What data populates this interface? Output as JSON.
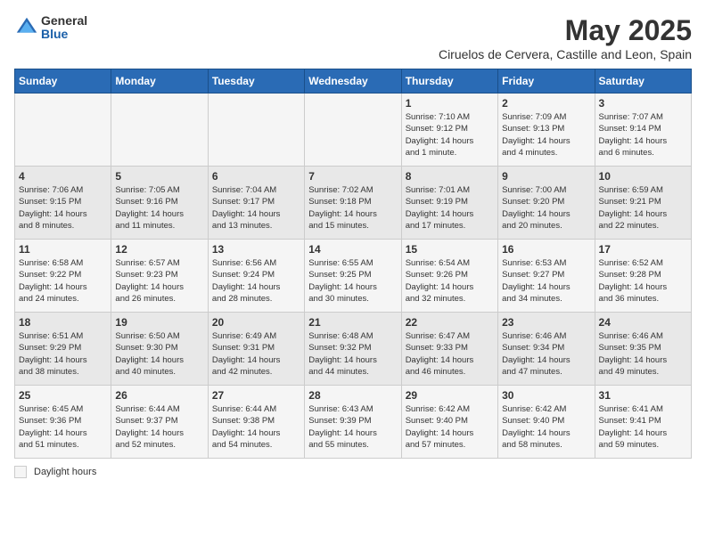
{
  "logo": {
    "general": "General",
    "blue": "Blue"
  },
  "title": "May 2025",
  "subtitle": "Ciruelos de Cervera, Castille and Leon, Spain",
  "columns": [
    "Sunday",
    "Monday",
    "Tuesday",
    "Wednesday",
    "Thursday",
    "Friday",
    "Saturday"
  ],
  "weeks": [
    [
      {
        "day": "",
        "info": ""
      },
      {
        "day": "",
        "info": ""
      },
      {
        "day": "",
        "info": ""
      },
      {
        "day": "",
        "info": ""
      },
      {
        "day": "1",
        "info": "Sunrise: 7:10 AM\nSunset: 9:12 PM\nDaylight: 14 hours\nand 1 minute."
      },
      {
        "day": "2",
        "info": "Sunrise: 7:09 AM\nSunset: 9:13 PM\nDaylight: 14 hours\nand 4 minutes."
      },
      {
        "day": "3",
        "info": "Sunrise: 7:07 AM\nSunset: 9:14 PM\nDaylight: 14 hours\nand 6 minutes."
      }
    ],
    [
      {
        "day": "4",
        "info": "Sunrise: 7:06 AM\nSunset: 9:15 PM\nDaylight: 14 hours\nand 8 minutes."
      },
      {
        "day": "5",
        "info": "Sunrise: 7:05 AM\nSunset: 9:16 PM\nDaylight: 14 hours\nand 11 minutes."
      },
      {
        "day": "6",
        "info": "Sunrise: 7:04 AM\nSunset: 9:17 PM\nDaylight: 14 hours\nand 13 minutes."
      },
      {
        "day": "7",
        "info": "Sunrise: 7:02 AM\nSunset: 9:18 PM\nDaylight: 14 hours\nand 15 minutes."
      },
      {
        "day": "8",
        "info": "Sunrise: 7:01 AM\nSunset: 9:19 PM\nDaylight: 14 hours\nand 17 minutes."
      },
      {
        "day": "9",
        "info": "Sunrise: 7:00 AM\nSunset: 9:20 PM\nDaylight: 14 hours\nand 20 minutes."
      },
      {
        "day": "10",
        "info": "Sunrise: 6:59 AM\nSunset: 9:21 PM\nDaylight: 14 hours\nand 22 minutes."
      }
    ],
    [
      {
        "day": "11",
        "info": "Sunrise: 6:58 AM\nSunset: 9:22 PM\nDaylight: 14 hours\nand 24 minutes."
      },
      {
        "day": "12",
        "info": "Sunrise: 6:57 AM\nSunset: 9:23 PM\nDaylight: 14 hours\nand 26 minutes."
      },
      {
        "day": "13",
        "info": "Sunrise: 6:56 AM\nSunset: 9:24 PM\nDaylight: 14 hours\nand 28 minutes."
      },
      {
        "day": "14",
        "info": "Sunrise: 6:55 AM\nSunset: 9:25 PM\nDaylight: 14 hours\nand 30 minutes."
      },
      {
        "day": "15",
        "info": "Sunrise: 6:54 AM\nSunset: 9:26 PM\nDaylight: 14 hours\nand 32 minutes."
      },
      {
        "day": "16",
        "info": "Sunrise: 6:53 AM\nSunset: 9:27 PM\nDaylight: 14 hours\nand 34 minutes."
      },
      {
        "day": "17",
        "info": "Sunrise: 6:52 AM\nSunset: 9:28 PM\nDaylight: 14 hours\nand 36 minutes."
      }
    ],
    [
      {
        "day": "18",
        "info": "Sunrise: 6:51 AM\nSunset: 9:29 PM\nDaylight: 14 hours\nand 38 minutes."
      },
      {
        "day": "19",
        "info": "Sunrise: 6:50 AM\nSunset: 9:30 PM\nDaylight: 14 hours\nand 40 minutes."
      },
      {
        "day": "20",
        "info": "Sunrise: 6:49 AM\nSunset: 9:31 PM\nDaylight: 14 hours\nand 42 minutes."
      },
      {
        "day": "21",
        "info": "Sunrise: 6:48 AM\nSunset: 9:32 PM\nDaylight: 14 hours\nand 44 minutes."
      },
      {
        "day": "22",
        "info": "Sunrise: 6:47 AM\nSunset: 9:33 PM\nDaylight: 14 hours\nand 46 minutes."
      },
      {
        "day": "23",
        "info": "Sunrise: 6:46 AM\nSunset: 9:34 PM\nDaylight: 14 hours\nand 47 minutes."
      },
      {
        "day": "24",
        "info": "Sunrise: 6:46 AM\nSunset: 9:35 PM\nDaylight: 14 hours\nand 49 minutes."
      }
    ],
    [
      {
        "day": "25",
        "info": "Sunrise: 6:45 AM\nSunset: 9:36 PM\nDaylight: 14 hours\nand 51 minutes."
      },
      {
        "day": "26",
        "info": "Sunrise: 6:44 AM\nSunset: 9:37 PM\nDaylight: 14 hours\nand 52 minutes."
      },
      {
        "day": "27",
        "info": "Sunrise: 6:44 AM\nSunset: 9:38 PM\nDaylight: 14 hours\nand 54 minutes."
      },
      {
        "day": "28",
        "info": "Sunrise: 6:43 AM\nSunset: 9:39 PM\nDaylight: 14 hours\nand 55 minutes."
      },
      {
        "day": "29",
        "info": "Sunrise: 6:42 AM\nSunset: 9:40 PM\nDaylight: 14 hours\nand 57 minutes."
      },
      {
        "day": "30",
        "info": "Sunrise: 6:42 AM\nSunset: 9:40 PM\nDaylight: 14 hours\nand 58 minutes."
      },
      {
        "day": "31",
        "info": "Sunrise: 6:41 AM\nSunset: 9:41 PM\nDaylight: 14 hours\nand 59 minutes."
      }
    ]
  ],
  "footer": {
    "legend": "Daylight hours"
  }
}
